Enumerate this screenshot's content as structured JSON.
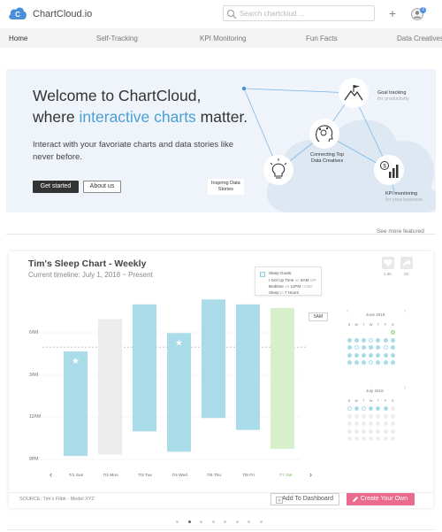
{
  "brand": {
    "name": "ChartCloud.io",
    "logo_letter": "C"
  },
  "search": {
    "placeholder": "Search chartcloud ..."
  },
  "header": {
    "notification_count": "3"
  },
  "nav": [
    {
      "label": "Home"
    },
    {
      "label": "Self-Tracking"
    },
    {
      "label": "KPI Monitoring"
    },
    {
      "label": "Fun Facts"
    },
    {
      "label": "Data Creatives"
    }
  ],
  "hero": {
    "title_line1": "Welcome to ChartCloud,",
    "title_line2_pre": "where ",
    "title_line2_accent": "interactive charts",
    "title_line2_post": " matter.",
    "subtitle": "Interact with your favoriate charts and data stories like never before.",
    "primary_button": "Get started",
    "secondary_button": "About us",
    "diagram": {
      "goal_title": "Goal tracking",
      "goal_sub": "for productivity",
      "connect_line1": "Connecting Top",
      "connect_line2": "Data Creatives",
      "inspire_line1": "Inspring Data",
      "inspire_line2": "Stories",
      "kpi_title": "KPI monitoring",
      "kpi_sub": "for your business"
    }
  },
  "featured": {
    "see_more": "See more featured"
  },
  "chart_card": {
    "heart_count": "1.9K",
    "share_count": "32",
    "legend": {
      "title": "Sleep Goals:",
      "line1_a": "I Get Up Time",
      "line1_b": " on ",
      "line1_c": "5AM",
      "line1_d": " OR",
      "line2_a": "Bedtime",
      "line2_b": " on ",
      "line2_c": "11PM",
      "line2_d": " I AND",
      "line3_a": "Sleep",
      "line3_b": " in ",
      "line3_c": "7 Hours"
    },
    "goal_label": "5AM",
    "source": "SOURCE: Tim's Fitbit - Model XYZ",
    "add_button": "Add To Dashboard",
    "create_button": "Create Your Own"
  },
  "chart_data": {
    "type": "bar",
    "title": "Tim's Sleep Chart - Weekly",
    "subtitle": "Current timeline: July 1, 2018 ~ Present",
    "y_ticks": [
      "6AM",
      "3AM",
      "12AM",
      "9PM"
    ],
    "x_categories": [
      "7/1 Sun",
      "7/2 Mon",
      "7/3 Tue",
      "7/4 Wed",
      "7/5 Thu",
      "7/6 Fri",
      "7/7 Sat"
    ],
    "y_axis_top_hour_from_9pm": 10.5,
    "goal_wake_hours_from_9pm": 8,
    "bars": [
      {
        "day": "7/1 Sun",
        "sleep_start": 21.25,
        "wake": 4.7,
        "state": "normal",
        "star": true
      },
      {
        "day": "7/2 Mon",
        "sleep_start": 21.35,
        "wake": 7.0,
        "state": "inactive",
        "star": false
      },
      {
        "day": "7/3 Tue",
        "sleep_start": 23.0,
        "wake": 8.05,
        "state": "normal",
        "star": false
      },
      {
        "day": "7/4 Wed",
        "sleep_start": 21.55,
        "wake": 6.0,
        "state": "normal",
        "star": true
      },
      {
        "day": "7/5 Thu",
        "sleep_start": 23.95,
        "wake": 8.4,
        "state": "normal",
        "star": false
      },
      {
        "day": "7/6 Fri",
        "sleep_start": 23.1,
        "wake": 8.05,
        "state": "normal",
        "star": false
      },
      {
        "day": "7/7 Sat",
        "sleep_start": 21.75,
        "wake": 7.8,
        "state": "current",
        "star": false
      }
    ],
    "colors": {
      "normal": "#a9dbe8",
      "inactive": "#ececec",
      "current": "#d8efcc",
      "goal_line": "#bdbdbd"
    }
  },
  "calendars": [
    {
      "title": "June 2018",
      "days": [
        "S",
        "M",
        "T",
        "W",
        "T",
        "F",
        "S"
      ],
      "cells": [
        "e",
        "e",
        "e",
        "e",
        "e",
        "e",
        "l",
        "f",
        "f",
        "f",
        "o",
        "f",
        "f",
        "f",
        "f",
        "o",
        "f",
        "f",
        "f",
        "o",
        "f",
        "f",
        "f",
        "f",
        "f",
        "f",
        "f",
        "f",
        "f",
        "f",
        "f",
        "o",
        "f",
        "f",
        "f"
      ]
    },
    {
      "title": "July 2018",
      "days": [
        "S",
        "M",
        "T",
        "W",
        "T",
        "F",
        "S"
      ],
      "cells": [
        "o",
        "f",
        "o",
        "f",
        "f",
        "f",
        "g",
        "g",
        "g",
        "g",
        "g",
        "g",
        "g",
        "g",
        "g",
        "g",
        "g",
        "g",
        "g",
        "g",
        "g",
        "g",
        "g",
        "g",
        "g",
        "g",
        "g",
        "g",
        "g",
        "g",
        "g",
        "g",
        "g",
        "g",
        "g"
      ]
    }
  ],
  "pager": {
    "count": 8,
    "active": 1
  }
}
